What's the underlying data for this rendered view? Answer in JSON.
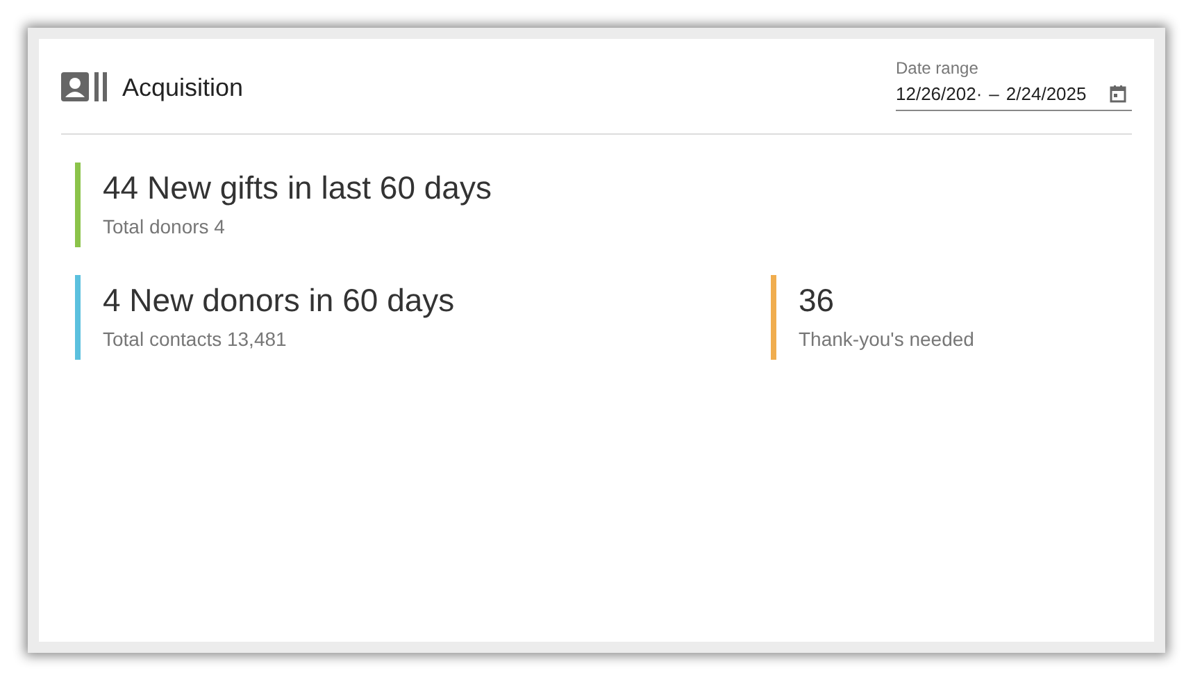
{
  "card": {
    "title": "Acquisition"
  },
  "date_range": {
    "label": "Date range",
    "start": "12/26/202·",
    "separator": "–",
    "end": "2/24/2025"
  },
  "metric_rows": [
    [
      {
        "headline": "44 New gifts in last 60 days",
        "subtext": "Total donors 4",
        "color": "#8bc34a"
      }
    ],
    [
      {
        "headline": "4 New donors in 60 days",
        "subtext": "Total contacts 13,481",
        "color": "#5bc0de"
      },
      {
        "headline": "36",
        "subtext": "Thank-you's needed",
        "color": "#f0ad4e"
      }
    ]
  ]
}
